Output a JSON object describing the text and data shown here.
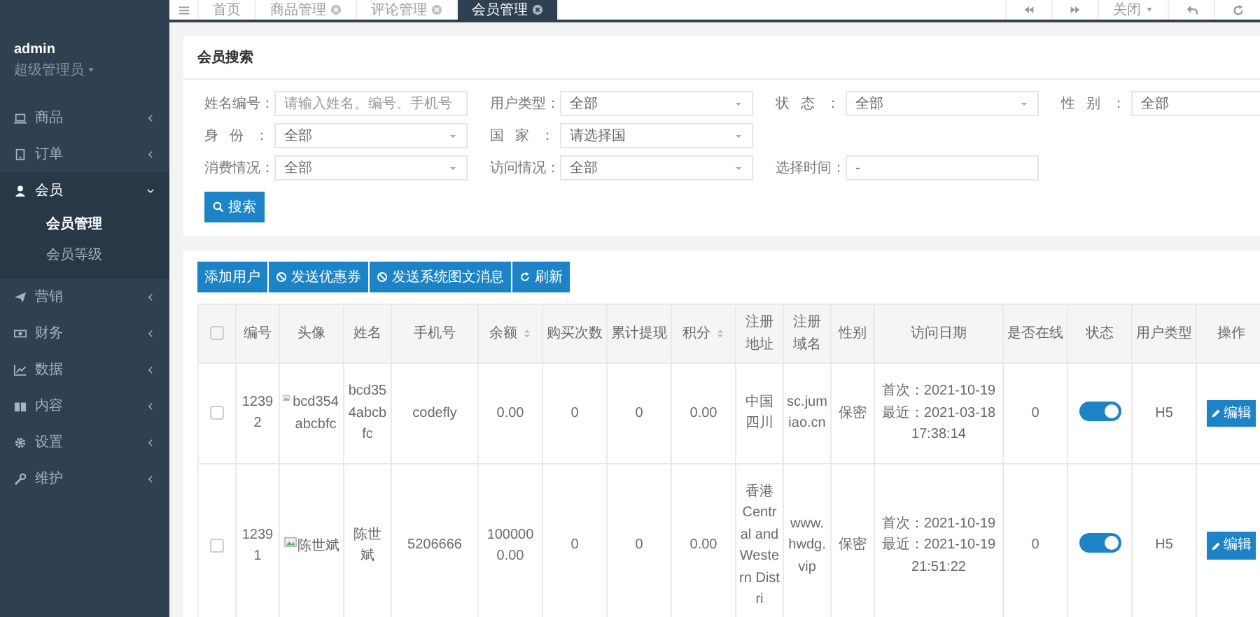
{
  "sidebar": {
    "user": "admin",
    "role": "超级管理员",
    "items": [
      {
        "label": "商品",
        "expanded": false
      },
      {
        "label": "订单",
        "expanded": false
      },
      {
        "label": "会员",
        "expanded": true,
        "children": [
          {
            "label": "会员管理",
            "selected": true
          },
          {
            "label": "会员等级",
            "selected": false
          }
        ]
      },
      {
        "label": "营销",
        "expanded": false
      },
      {
        "label": "财务",
        "expanded": false
      },
      {
        "label": "数据",
        "expanded": false
      },
      {
        "label": "内容",
        "expanded": false
      },
      {
        "label": "设置",
        "expanded": false
      },
      {
        "label": "维护",
        "expanded": false
      }
    ]
  },
  "tabs": [
    {
      "label": "首页",
      "closable": false,
      "selected": false
    },
    {
      "label": "商品管理",
      "closable": true,
      "selected": false
    },
    {
      "label": "评论管理",
      "closable": true,
      "selected": false
    },
    {
      "label": "会员管理",
      "closable": true,
      "selected": true
    }
  ],
  "toolbar": {
    "close_menu": "关闭"
  },
  "search": {
    "title": "会员搜索",
    "rows": [
      [
        {
          "label": "姓名编号：",
          "kind": "text",
          "placeholder": "请输入姓名、编号、手机号"
        },
        {
          "label": "用户类型：",
          "kind": "select",
          "value": "全部"
        },
        {
          "label": "状态：",
          "kind": "select",
          "value": "全部"
        },
        {
          "label": "性别：",
          "kind": "select",
          "value": "全部"
        }
      ],
      [
        {
          "label": "身份：",
          "kind": "select",
          "value": "全部"
        },
        {
          "label": "国家：",
          "kind": "select",
          "value": "请选择国"
        }
      ],
      [
        {
          "label": "消费情况：",
          "kind": "select",
          "value": "全部"
        },
        {
          "label": "访问情况：",
          "kind": "select",
          "value": "全部"
        },
        {
          "label": "选择时间：",
          "kind": "text",
          "value": "-"
        }
      ]
    ],
    "button": "搜索"
  },
  "table_actions": [
    "添加用户",
    "发送优惠券",
    "发送系统图文消息",
    "刷新"
  ],
  "table": {
    "columns": [
      {
        "kind": "check",
        "checked": false
      },
      {
        "label": "编号",
        "sortable": false
      },
      {
        "label": "头像",
        "sortable": false
      },
      {
        "label": "姓名",
        "sortable": false
      },
      {
        "label": "手机号",
        "sortable": false
      },
      {
        "label": "余额",
        "sortable": true
      },
      {
        "label": "购买次数",
        "sortable": false
      },
      {
        "label": "累计提现",
        "sortable": false
      },
      {
        "label": "积分",
        "sortable": true
      },
      {
        "label": "注册地址",
        "sortable": false
      },
      {
        "label": "注册域名",
        "sortable": false
      },
      {
        "label": "性别",
        "sortable": false
      },
      {
        "label": "访问日期",
        "sortable": false
      },
      {
        "label": "是否在线",
        "sortable": false
      },
      {
        "label": "状态",
        "sortable": false
      },
      {
        "label": "用户类型",
        "sortable": false
      },
      {
        "label": "操作",
        "sortable": false
      }
    ],
    "rows": [
      {
        "checked": false,
        "id": "12392",
        "avatar_alt": "bcd354abcbfc",
        "name": "bcd354abcbfc",
        "phone": "codefly",
        "balance": "0.00",
        "purchases": "0",
        "withdrawn": "0",
        "points": "0.00",
        "address": "中国四川",
        "domain": "sc.jumiao.cn",
        "gender": "保密",
        "first_visit": "首次：2021-10-19",
        "last_visit": "最近：2021-03-18 17:38:14",
        "online": "0",
        "status_on": true,
        "user_type": "H5",
        "action": "编辑"
      },
      {
        "checked": false,
        "id": "12391",
        "avatar_alt": "陈世斌",
        "name": "陈世斌",
        "phone": "5206666",
        "balance": "1000000.00",
        "purchases": "0",
        "withdrawn": "0",
        "points": "0.00",
        "address": "香港 Central and Western Distri",
        "domain": "www.hwdg.vip",
        "gender": "保密",
        "first_visit": "首次：2021-10-19",
        "last_visit": "最近：2021-10-19 21:51:22",
        "online": "0",
        "status_on": true,
        "user_type": "H5",
        "action": "编辑"
      }
    ]
  }
}
